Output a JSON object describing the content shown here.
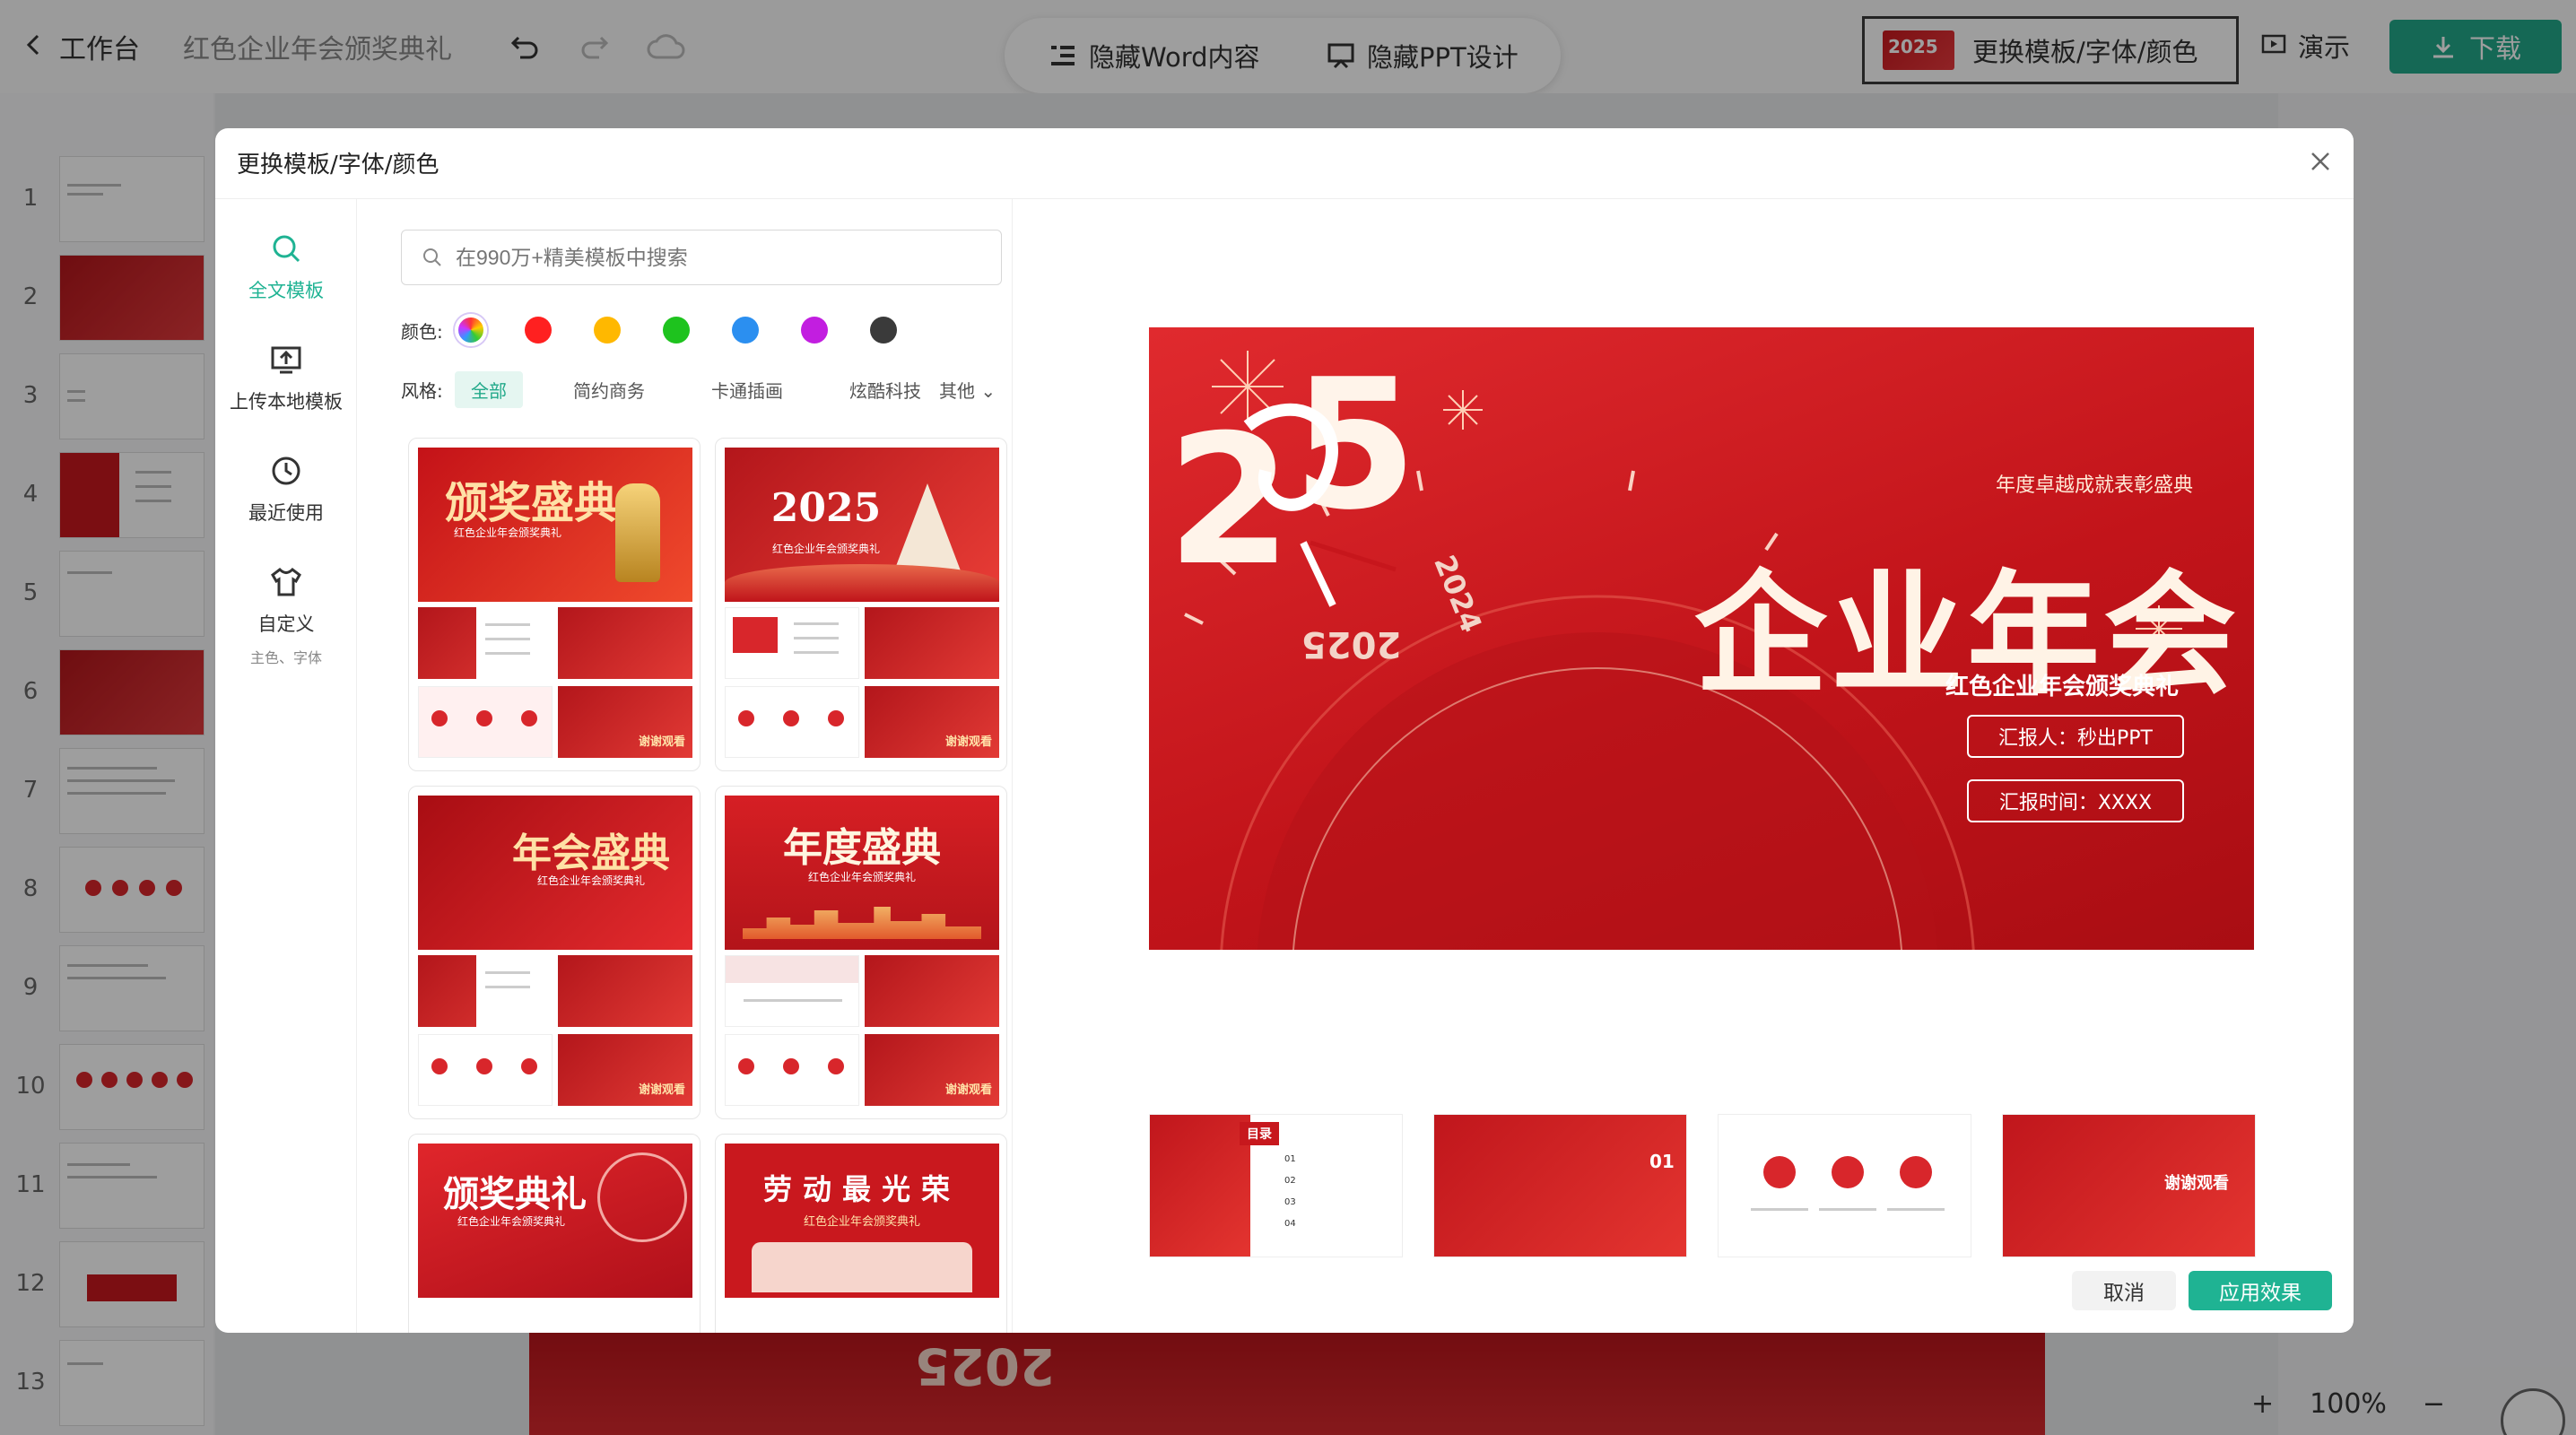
{
  "topbar": {
    "back_label": "工作台",
    "doc_title": "红色企业年会颁奖典礼",
    "hide_word": "隐藏Word内容",
    "hide_ppt": "隐藏PPT设计",
    "template_btn": "更换模板/字体/颜色",
    "template_btn_thumb_text": "2025",
    "present": "演示",
    "download": "下载"
  },
  "slides": [
    "1",
    "2",
    "3",
    "4",
    "5",
    "6",
    "7",
    "8",
    "9",
    "10",
    "11",
    "12",
    "13"
  ],
  "zoom": {
    "plus": "+",
    "level": "100%",
    "minus": "−"
  },
  "canvas": {
    "partial_text": "2025"
  },
  "dialog": {
    "title": "更换模板/字体/颜色",
    "sidebar": [
      {
        "label": "全文模板",
        "icon": "search-icon"
      },
      {
        "label": "上传本地模板",
        "icon": "upload-icon"
      },
      {
        "label": "最近使用",
        "icon": "clock-icon"
      },
      {
        "label": "自定义",
        "icon": "shirt-icon",
        "sub": "主色、字体"
      }
    ],
    "search_placeholder": "在990万+精美模板中搜索",
    "color_label": "颜色:",
    "colors": [
      "#ff2020",
      "#ffb800",
      "#1ec31e",
      "#2b8ff0",
      "#c21ee0",
      "#3a3a3a"
    ],
    "style_label": "风格:",
    "styles": [
      "全部",
      "简约商务",
      "卡通插画",
      "炫酷科技"
    ],
    "style_more": "其他",
    "cards": [
      {
        "title": "颁奖盛典",
        "sub": "红色企业年会颁奖典礼"
      },
      {
        "title": "2025",
        "sub": "红色企业年会颁奖典礼"
      },
      {
        "title": "年会盛典",
        "sub": "红色企业年会颁奖典礼"
      },
      {
        "title": "年度盛典",
        "sub": "红色企业年会颁奖典礼"
      },
      {
        "title": "颁奖典礼",
        "sub": "红色企业年会颁奖典礼"
      },
      {
        "title": "劳动最光荣",
        "sub": "红色企业年会颁奖典礼"
      }
    ],
    "card_mini_labels": [
      "目录",
      "谢谢观看"
    ],
    "preview": {
      "kicker": "年度卓越成就表彰盛典",
      "title": "企业年会",
      "subtitle": "红色企业年会颁奖典礼",
      "reporter": "汇报人：秒出PPT",
      "time": "汇报时间：XXXX",
      "year": "2025",
      "dial_2024": "2024",
      "dial_2025": "2025"
    },
    "thumbs": [
      {
        "label": "目录",
        "items": [
          "01",
          "02",
          "03",
          "04"
        ]
      },
      {
        "label": "01"
      },
      {
        "label": ""
      },
      {
        "label": "谢谢观看"
      }
    ],
    "cancel": "取消",
    "apply": "应用效果"
  }
}
